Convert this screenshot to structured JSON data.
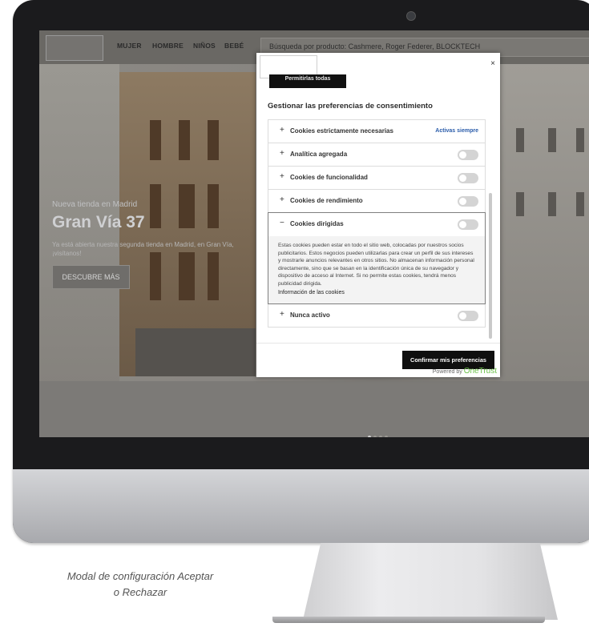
{
  "nav": {
    "links": [
      "MUJER",
      "HOMBRE",
      "NIÑOS",
      "BEBÉ"
    ],
    "search_placeholder": "Búsqueda por producto: Cashmere, Roger Federer, BLOCKTECH"
  },
  "hero": {
    "subtitle": "Nueva tienda en Madrid",
    "title": "Gran Vía 37",
    "description": "Ya está abierta nuestra segunda tienda en Madrid, en Gran Vía, ¡visítanos!",
    "button": "DESCUBRE MÁS"
  },
  "modal": {
    "close_label": "×",
    "accept_all_label": "Permitirlas todas",
    "prefs_title": "Gestionar las preferencias de consentimiento",
    "categories": [
      {
        "sign": "+",
        "label": "Cookies estrictamente necesarias",
        "status": "Activas siempre"
      },
      {
        "sign": "+",
        "label": "Analítica agregada",
        "enabled": false
      },
      {
        "sign": "+",
        "label": "Cookies de funcionalidad",
        "enabled": false
      },
      {
        "sign": "+",
        "label": "Cookies de rendimiento",
        "enabled": false
      },
      {
        "sign": "−",
        "label": "Cookies dirigidas",
        "enabled": false,
        "expanded": true,
        "description": "Estas cookies pueden estar en todo el sitio web, colocadas por nuestros socios publicitarios. Estos negocios pueden utilizarlas para crear un perfil de sus intereses y mostrarle anuncios relevantes en otros sitios. No almacenan información personal directamente, sino que se basan en la identificación única de su navegador y dispositivo de acceso al Internet. Si no permite estas cookies, tendrá menos publicidad dirigida.",
        "info_link": "Información de las cookies"
      },
      {
        "sign": "+",
        "label": "Nunca activo",
        "enabled": false
      }
    ],
    "confirm_label": "Confirmar mis preferencias",
    "powered_by": "Powered by",
    "powered_brand": "OneTrust"
  },
  "caption": {
    "line1": "Modal de configuración Aceptar",
    "line2": "o Rechazar"
  }
}
